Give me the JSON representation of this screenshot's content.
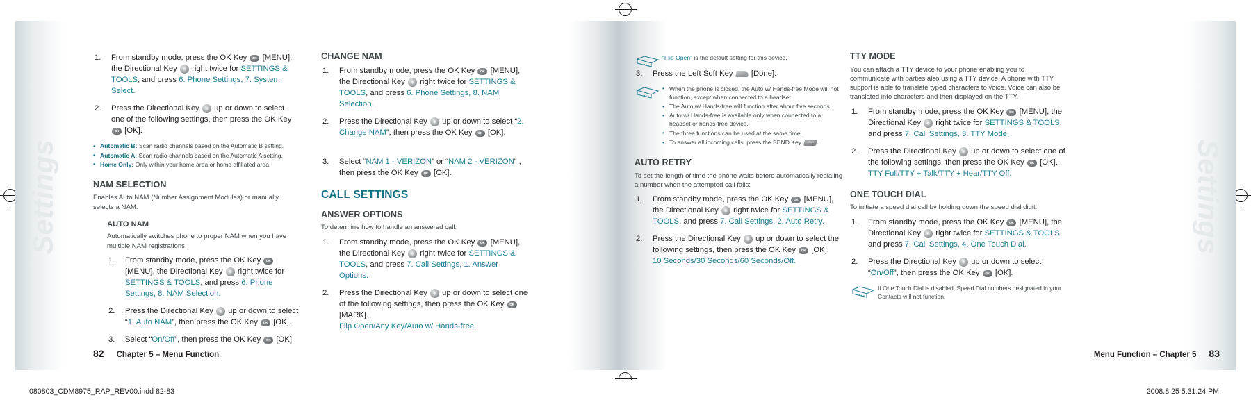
{
  "document": {
    "tab_label_left": "Settings",
    "tab_label_right": "Settings",
    "scan_footer_left": "080803_CDM8975_RAP_REV00.indd   82-83",
    "scan_footer_right": "2008.8.25   5:31:24 PM"
  },
  "left_page": {
    "page_number": "82",
    "footer_text": "Chapter 5 – Menu Function"
  },
  "right_page": {
    "page_number": "83",
    "footer_text": "Menu Function – Chapter 5"
  },
  "col1": {
    "step1": {
      "a": "From standby mode, press the OK Key",
      "b": "[MENU], the Directional Key",
      "c": "right twice for",
      "d": "SETTINGS & TOOLS",
      "e": ", and press",
      "f": "6. Phone Settings, 7. System Select",
      "g": "."
    },
    "step2": {
      "a": "Press the Directional Key",
      "b": "up or down to select one of the following settings, then press the OK Key",
      "c": "[OK]."
    },
    "bullets": [
      {
        "term": "Automatic B:",
        "desc": "Scan radio channels based on the Automatic B setting."
      },
      {
        "term": "Automatic A:",
        "desc": "Scan radio channels based on the Automatic A setting."
      },
      {
        "term": "Home Only:",
        "desc": "Only within your home area or home affiliated area."
      }
    ],
    "nam_selection_heading": "NAM SELECTION",
    "nam_selection_body": "Enables Auto NAM (Number Assignment Modules) or manually selects a NAM.",
    "auto_nam_heading": "AUTO NAM",
    "auto_nam_body": "Automatically switches phone to proper NAM when you have multiple NAM registrations.",
    "auto_step1": {
      "a": "From standby mode, press the OK Key",
      "b": "[MENU], the Directional Key",
      "c": "right twice for",
      "d": "SETTINGS & TOOLS",
      "e": ", and press",
      "f": "6. Phone Settings, 8. NAM Selection",
      "g": "."
    },
    "auto_step2": {
      "a": "Press the Directional Key",
      "b": "up or down to select “",
      "c": "1. Auto NAM",
      "d": "”, then press the OK Key",
      "e": "[OK]."
    },
    "auto_step3": {
      "a": "Select “",
      "b": "On/Off",
      "c": "”, then press the OK Key",
      "d": "[OK]."
    }
  },
  "col2": {
    "change_nam_heading": "CHANGE NAM",
    "step1": {
      "a": "From standby mode, press the OK Key",
      "b": "[MENU], the Directional Key",
      "c": "right twice for",
      "d": "SETTINGS & TOOLS",
      "e": ", and press",
      "f": "6. Phone Settings, 8. NAM Selection",
      "g": "."
    },
    "step2": {
      "a": "Press the Directional Key",
      "b": "up or down to select “",
      "c": "2. Change NAM",
      "d": "”, then press the OK Key",
      "e": "[OK]."
    },
    "step3": {
      "a": "Select “",
      "b": "NAM 1 - VERIZON",
      "c": "” or “",
      "d": "NAM 2 - VERIZON",
      "e": "” , then press the OK Key",
      "f": "[OK]."
    },
    "call_settings_heading": "CALL SETTINGS",
    "answer_options_heading": "ANSWER OPTIONS",
    "answer_options_body": "To determine how to handle an answered call:",
    "ao_step1": {
      "a": "From standby mode, press the OK Key",
      "b": "[MENU], the Directional Key",
      "c": "right twice for",
      "d": "SETTINGS & TOOLS",
      "e": ", and press",
      "f": "7. Call Settings, 1. Answer Options",
      "g": "."
    },
    "ao_step2": {
      "a": "Press the Directional Key",
      "b": "up or down to select one of the following settings, then press the OK Key",
      "c": "[MARK].",
      "d": "Flip Open/Any Key/Auto w/ Hands-free",
      "e": "."
    }
  },
  "col3": {
    "note_flip": {
      "quoted": "“Flip Open”",
      "rest": " is the default setting for this device."
    },
    "step3": {
      "a": "Press the Left Soft Key",
      "b": "[Done]."
    },
    "note_bullets": [
      "When the phone is closed, the Auto w/ Hands-free Mode will not function, except when connected to a headset.",
      "The Auto w/ Hands-free will function after about five seconds.",
      "Auto w/ Hands-free is available only when connected to a headset or hands-free device.",
      "The three functions can be used at the same time."
    ],
    "note_bullet_send_prefix": "To answer all incoming calls, press the SEND Key",
    "note_bullet_send_suffix": ".",
    "auto_retry_heading": "AUTO RETRY",
    "auto_retry_body": "To set the length of time the phone waits before automatically redialing a number when the attempted call fails:",
    "ar_step1": {
      "a": "From standby mode, press the OK Key",
      "b": "[MENU], the Directional Key",
      "c": "right twice for",
      "d": "SETTINGS & TOOLS",
      "e": ", and press",
      "f": "7. Call Settings, 2. Auto Retry",
      "g": "."
    },
    "ar_step2": {
      "a": "Press the Directional Key",
      "b": "up or down to select the following settings, then press the OK Key",
      "c": "[OK].",
      "d": "10 Seconds/30 Seconds/60 Seconds/Off",
      "e": "."
    }
  },
  "col4": {
    "tty_heading": "TTY MODE",
    "tty_body": "You can attach a TTY device to your phone enabling you to communicate with parties also using a TTY device. A phone with TTY support is able to translate typed characters to voice. Voice can also be translated into characters and then displayed on the TTY.",
    "tty_step1": {
      "a": "From standby mode, press the OK Key",
      "b": "[MENU], the Directional Key",
      "c": "right twice for",
      "d": "SETTINGS & TOOLS",
      "e": ", and press",
      "f": "7. Call Settings, 3. TTY Mode",
      "g": "."
    },
    "tty_step2": {
      "a": "Press the Directional Key",
      "b": "up or down to select one of the following settings, then press the OK Key",
      "c": "[OK].",
      "d": "TTY Full/TTY + Talk/TTY + Hear/TTY Off",
      "e": "."
    },
    "otd_heading": "ONE TOUCH DIAL",
    "otd_body": "To initiate a speed dial call by holding down the speed dial digit:",
    "otd_step1": {
      "a": "From standby mode, press the OK Key",
      "b": "[MENU], the Directional Key",
      "c": "right twice for",
      "d": "SETTINGS & TOOLS",
      "e": ", and press",
      "f": "7. Call Settings, 4. One Touch Dial",
      "g": "."
    },
    "otd_step2": {
      "a": "Press the Directional Key",
      "b": "up or down to select “",
      "c": "On/Off",
      "d": "”, then press the OK Key",
      "e": "[OK]."
    },
    "otd_note": "If One Touch Dial is disabled, Speed Dial numbers designated in your Contacts will not function."
  },
  "colors": {
    "teal": "#1b7d92",
    "heading_teal": "#157085",
    "body_gray": "#3d4345",
    "ink": "#231f20"
  }
}
